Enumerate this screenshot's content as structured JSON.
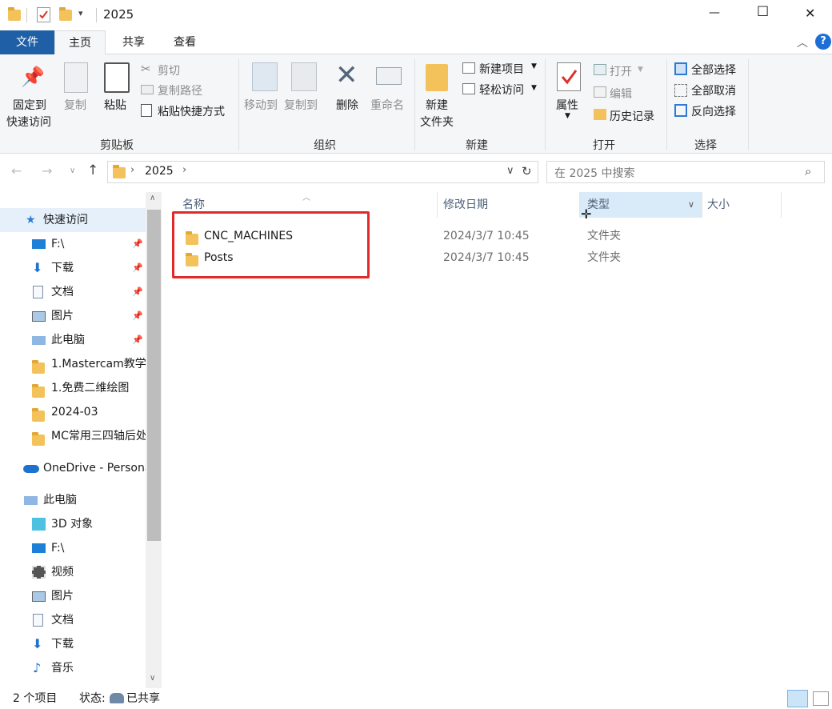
{
  "titlebar": {
    "title": "2025",
    "minimize": "—",
    "maximize": "☐",
    "close": "✕"
  },
  "tabs": {
    "file": "文件",
    "home": "主页",
    "share": "共享",
    "view": "查看"
  },
  "ribbon": {
    "clipboard": {
      "pin": "固定到\n快速访问",
      "pin1": "固定到",
      "pin2": "快速访问",
      "copy": "复制",
      "paste": "粘贴",
      "cut": "剪切",
      "copy_path": "复制路径",
      "paste_shortcut": "粘贴快捷方式",
      "label": "剪贴板"
    },
    "organize": {
      "move_to": "移动到",
      "copy_to": "复制到",
      "delete": "删除",
      "rename": "重命名",
      "label": "组织"
    },
    "new": {
      "new_folder1": "新建",
      "new_folder2": "文件夹",
      "new_item": "新建项目",
      "easy_access": "轻松访问",
      "label": "新建"
    },
    "open": {
      "properties": "属性",
      "open": "打开",
      "edit": "编辑",
      "history": "历史记录",
      "label": "打开"
    },
    "select": {
      "select_all": "全部选择",
      "select_none": "全部取消",
      "invert": "反向选择",
      "label": "选择"
    }
  },
  "address": {
    "crumb": "2025",
    "search_placeholder": "在 2025 中搜索"
  },
  "nav": {
    "items": [
      {
        "label": "快速访问"
      },
      {
        "label": "F:\\"
      },
      {
        "label": "下载"
      },
      {
        "label": "文档"
      },
      {
        "label": "图片"
      },
      {
        "label": "此电脑"
      },
      {
        "label": "1.Mastercam教学"
      },
      {
        "label": "1.免费二维绘图"
      },
      {
        "label": "2024-03"
      },
      {
        "label": "MC常用三四轴后处"
      },
      {
        "label": "OneDrive - Personal"
      },
      {
        "label": "此电脑"
      },
      {
        "label": "3D 对象"
      },
      {
        "label": "F:\\"
      },
      {
        "label": "视频"
      },
      {
        "label": "图片"
      },
      {
        "label": "文档"
      },
      {
        "label": "下载"
      },
      {
        "label": "音乐"
      }
    ]
  },
  "columns": {
    "name": "名称",
    "date": "修改日期",
    "type": "类型",
    "size": "大小"
  },
  "files": [
    {
      "name": "CNC_MACHINES",
      "date": "2024/3/7 10:45",
      "type": "文件夹"
    },
    {
      "name": "Posts",
      "date": "2024/3/7 10:45",
      "type": "文件夹"
    }
  ],
  "status": {
    "count": "2 个项目",
    "state_label": "状态:",
    "state_value": "已共享"
  },
  "colors": {
    "accent": "#1f5fa6",
    "highlight": "#e12b2b",
    "selection": "#e5f0fb"
  }
}
